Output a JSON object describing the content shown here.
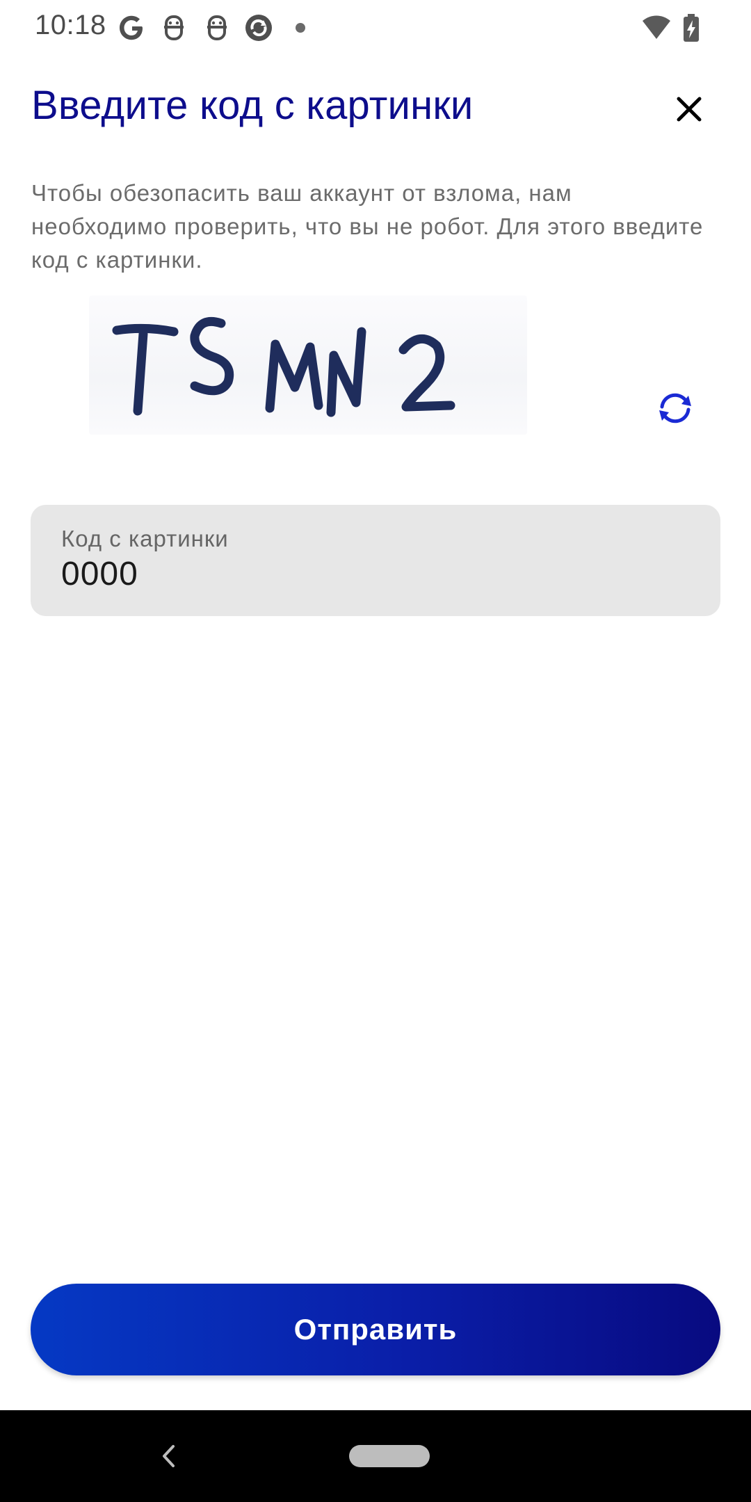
{
  "status_bar": {
    "time": "10:18",
    "icons": [
      "google-g-icon",
      "assistant-face-icon",
      "assistant-face-icon",
      "sync-circle-icon",
      "notification-dot-icon",
      "wifi-icon",
      "battery-charging-icon"
    ]
  },
  "header": {
    "title": "Введите код с картинки",
    "close_icon": "close-icon"
  },
  "description": "Чтобы обезопасить ваш аккаунт от взлома, нам необходимо проверить, что вы не робот. Для этого введите код с картинки.",
  "captcha": {
    "text": "TSMN2",
    "refresh_icon": "refresh-icon"
  },
  "code_field": {
    "label": "Код с картинки",
    "value": "0000"
  },
  "submit": {
    "label": "Отправить"
  },
  "nav_bar": {
    "back_icon": "back-chevron-icon",
    "home_icon": "home-pill-icon"
  },
  "colors": {
    "title": "#0d0d8c",
    "accent": "#1a2ad4",
    "button_gradient_start": "#0539c4",
    "button_gradient_end": "#080a80",
    "field_background": "#e7e7e7"
  }
}
